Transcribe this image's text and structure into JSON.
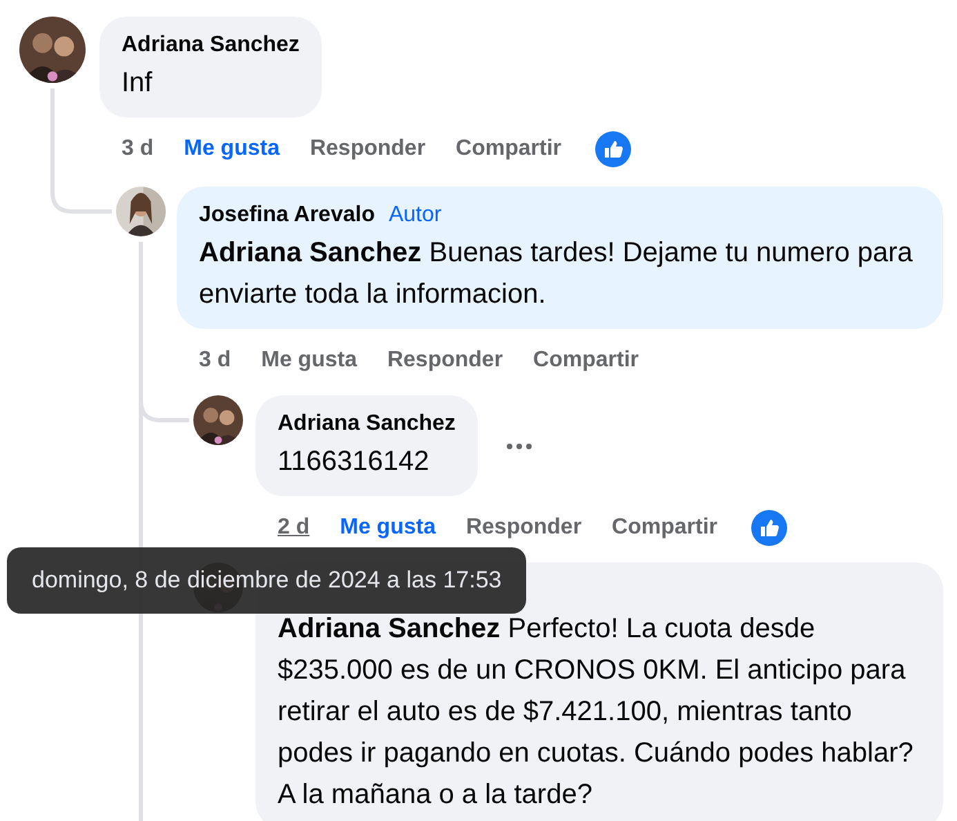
{
  "comments": [
    {
      "author": "Adriana Sanchez",
      "text": "Inf",
      "time": "3 d",
      "time_hovered": false,
      "like_label": "Me gusta",
      "liked": true,
      "reply_label": "Responder",
      "share_label": "Compartir",
      "show_more": false,
      "children": [
        {
          "author": "Josefina Arevalo",
          "badge": "Autor",
          "text": "**Adriana Sanchez** Buenas tardes! Dejame tu numero para enviarte toda la informacion.",
          "time": "3 d",
          "time_hovered": false,
          "like_label": "Me gusta",
          "liked": false,
          "reply_label": "Responder",
          "share_label": "Compartir",
          "show_more": false,
          "children": [
            {
              "author": "Adriana Sanchez",
              "text": "1166316142",
              "time": "2 d",
              "time_hovered": true,
              "like_label": "Me gusta",
              "liked": true,
              "reply_label": "Responder",
              "share_label": "Compartir",
              "show_more": true
            },
            {
              "text": "**Adriana Sanchez** Perfecto! La cuota desde $235.000 es de un CRONOS 0KM. El anticipo para retirar el auto es de $7.421.100, mientras tanto podes ir pagando en cuotas. Cuándo podes hablar? A la mañana o a la tarde?"
            }
          ]
        }
      ]
    }
  ],
  "tooltip": {
    "text": "domingo, 8 de diciembre de 2024 a las 17:53"
  }
}
